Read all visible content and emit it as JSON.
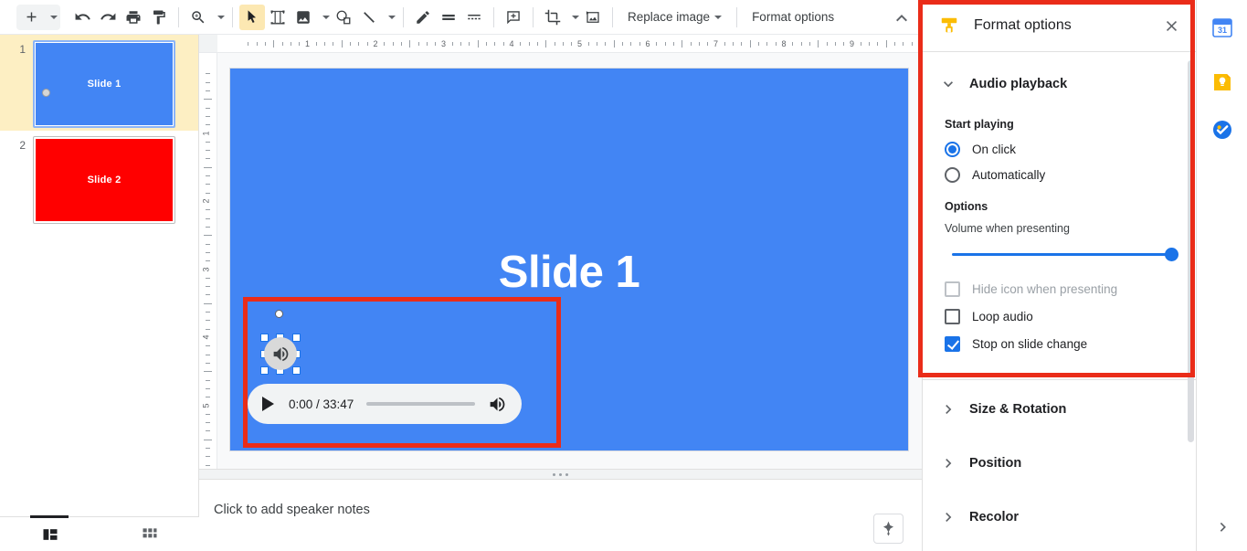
{
  "toolbar": {
    "buttons": [
      {
        "name": "new-slide-button",
        "icon": "plus-icon"
      },
      {
        "name": "new-slide-dropdown",
        "icon": "caret-down-icon"
      },
      {
        "name": "undo-button",
        "icon": "undo-icon"
      },
      {
        "name": "redo-button",
        "icon": "redo-icon"
      },
      {
        "name": "print-button",
        "icon": "printer-icon"
      },
      {
        "name": "paint-format-button",
        "icon": "paint-roller-icon"
      },
      {
        "name": "zoom-button",
        "icon": "magnifier-plus-icon"
      },
      {
        "name": "zoom-dropdown",
        "icon": "caret-down-icon"
      },
      {
        "name": "select-tool-button",
        "icon": "cursor-arrow-icon"
      },
      {
        "name": "text-box-button",
        "icon": "text-box-icon"
      },
      {
        "name": "insert-image-button",
        "icon": "image-icon"
      },
      {
        "name": "insert-image-dropdown",
        "icon": "caret-down-icon"
      },
      {
        "name": "insert-shape-button",
        "icon": "shape-icon"
      },
      {
        "name": "insert-line-button",
        "icon": "line-icon"
      },
      {
        "name": "insert-line-dropdown",
        "icon": "caret-down-icon"
      },
      {
        "name": "pen-button",
        "icon": "pen-icon"
      },
      {
        "name": "line-weight-button",
        "icon": "line-weight-icon"
      },
      {
        "name": "line-dash-button",
        "icon": "line-dash-icon"
      },
      {
        "name": "comment-button",
        "icon": "add-comment-icon"
      },
      {
        "name": "crop-button",
        "icon": "crop-icon"
      },
      {
        "name": "crop-dropdown",
        "icon": "caret-down-icon"
      },
      {
        "name": "mask-image-button",
        "icon": "mask-image-icon"
      }
    ],
    "replace_image_label": "Replace image",
    "format_options_label": "Format options",
    "collapse_label": "Hide the menus"
  },
  "filmstrip": {
    "slides": [
      {
        "number": "1",
        "title": "Slide 1",
        "bg": "#4285f4",
        "selected": true,
        "has_audio": true
      },
      {
        "number": "2",
        "title": "Slide 2",
        "bg": "#ff0000",
        "selected": false,
        "has_audio": false
      }
    ],
    "view_filmstrip_label": "Filmstrip view",
    "view_grid_label": "Grid view"
  },
  "rulers": {
    "horizontal_labels": [
      "1",
      "2",
      "3",
      "4",
      "5",
      "6",
      "7",
      "8",
      "9"
    ],
    "vertical_labels": [
      "1",
      "2",
      "3",
      "4",
      "5"
    ]
  },
  "slide": {
    "heading": "Slide 1",
    "background_color": "#4285f4",
    "audio": {
      "current_time": "0:00",
      "duration": "33:47",
      "time_display": "0:00 / 33:47",
      "play_label": "Play",
      "volume_label": "Volume",
      "progress_percent": 0
    }
  },
  "notes": {
    "placeholder": "Click to add speaker notes",
    "explore_label": "Explore"
  },
  "format_options": {
    "title": "Format options",
    "close_label": "Close",
    "icon": "format-paint-roller-icon",
    "accent_color": "#1a73e8",
    "highlight_color": "#ea2c19",
    "sections": [
      {
        "name": "audio-playback",
        "label": "Audio playback",
        "expanded": true,
        "chevron": "chevron-down-icon"
      },
      {
        "name": "size-and-rotation",
        "label": "Size & Rotation",
        "expanded": false,
        "chevron": "chevron-right-icon"
      },
      {
        "name": "position",
        "label": "Position",
        "expanded": false,
        "chevron": "chevron-right-icon"
      },
      {
        "name": "recolor",
        "label": "Recolor",
        "expanded": false,
        "chevron": "chevron-right-icon"
      }
    ],
    "start_playing": {
      "label": "Start playing",
      "options": [
        {
          "name": "on-click",
          "label": "On click",
          "selected": true
        },
        {
          "name": "automatically",
          "label": "Automatically",
          "selected": false
        }
      ]
    },
    "options": {
      "label": "Options",
      "volume_label": "Volume when presenting",
      "volume_value": 100,
      "checkboxes": [
        {
          "name": "hide-icon-when-presenting",
          "label": "Hide icon when presenting",
          "checked": false,
          "disabled": true
        },
        {
          "name": "loop-audio",
          "label": "Loop audio",
          "checked": false,
          "disabled": false
        },
        {
          "name": "stop-on-slide-change",
          "label": "Stop on slide change",
          "checked": true,
          "disabled": false
        }
      ]
    }
  },
  "right_rail": {
    "apps": [
      {
        "name": "google-calendar-icon",
        "label": "Calendar",
        "badge": "31"
      },
      {
        "name": "google-keep-icon",
        "label": "Keep"
      },
      {
        "name": "google-tasks-icon",
        "label": "Tasks"
      }
    ],
    "expand_label": "Show side panel"
  }
}
